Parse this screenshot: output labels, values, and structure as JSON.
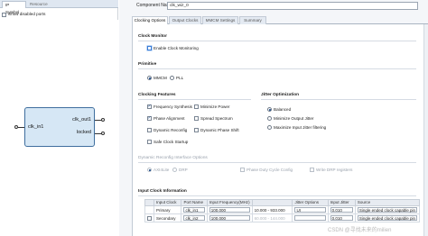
{
  "left_panel": {
    "tabs": [
      "IP Symbol",
      "Resource"
    ],
    "show_disabled_ports": "Show disabled ports",
    "block": {
      "input_ports": [
        "clk_in1"
      ],
      "output_ports": [
        "clk_out1",
        "locked"
      ]
    }
  },
  "component": {
    "label": "Component Name",
    "value": "clk_wiz_0"
  },
  "tabs": [
    "Clocking Options",
    "Output Clocks",
    "MMCM Settings",
    "Summary"
  ],
  "clock_monitor": {
    "title": "Clock Monitor",
    "enable_label": "Enable Clock Monitoring"
  },
  "primitive": {
    "title": "Primitive",
    "options": [
      "MMCM",
      "PLL"
    ],
    "selected": "MMCM"
  },
  "clocking_features": {
    "title": "Clocking Features",
    "items": [
      {
        "label": "Frequency Synthesis",
        "checked": true
      },
      {
        "label": "Minimize Power",
        "checked": false
      },
      {
        "label": "Phase Alignment",
        "checked": true
      },
      {
        "label": "Spread Spectrum",
        "checked": false
      },
      {
        "label": "Dynamic Reconfig",
        "checked": false
      },
      {
        "label": "Dynamic Phase Shift",
        "checked": false
      },
      {
        "label": "Safe Clock Startup",
        "checked": false
      }
    ]
  },
  "jitter_optimization": {
    "title": "Jitter Optimization",
    "options": [
      "Balanced",
      "Minimize Output Jitter",
      "Maximize Input Jitter filtering"
    ],
    "selected": "Balanced"
  },
  "dynamic_reconfig": {
    "title": "Dynamic Reconfig Interface Options",
    "interfaces": [
      "AXI4Lite",
      "DRP"
    ],
    "selected": "AXI4Lite",
    "phase_duty": "Phase Duty Cycle Config",
    "write_drp": "Write DRP registers"
  },
  "input_clock": {
    "title": "Input Clock Information",
    "headers": [
      "Input Clock",
      "Port Name",
      "Input Frequency(MHz)",
      "",
      "Jitter Options",
      "Input Jitter",
      "Source"
    ],
    "rows": [
      {
        "clock": "Primary",
        "port": "clk_in1",
        "freq": "100.000",
        "range": "10.000 - 933.000",
        "jitter_opt": "UI",
        "jitter": "0.010",
        "source": "Single ended clock capable pin"
      },
      {
        "clock": "Secondary",
        "port": "clk_in2",
        "freq": "100.000",
        "range": "60.000 - 144.000",
        "jitter_opt": "",
        "jitter": "0.010",
        "source": "Single ended clock capable pin"
      }
    ]
  },
  "watermark": "CSDN @寻找未来的milien"
}
